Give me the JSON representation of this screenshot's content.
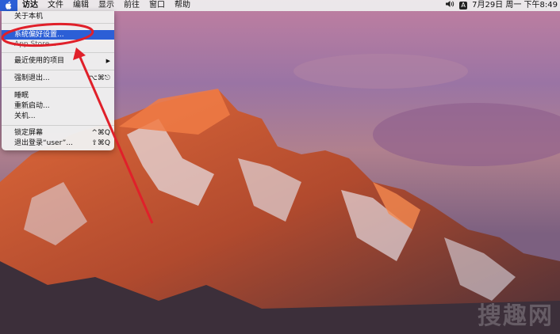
{
  "menubar": {
    "items": [
      "访达",
      "文件",
      "编辑",
      "显示",
      "前往",
      "窗口",
      "帮助"
    ],
    "input_badge": "A",
    "clock": "7月29日 周一 下午8:49"
  },
  "apple_menu": {
    "about": "关于本机",
    "system_prefs": "系统偏好设置...",
    "app_store": "App Store...",
    "recent": "最近使用的项目",
    "force_quit": "强制退出...",
    "force_quit_shortcut": "⌥⌘⎋",
    "sleep": "睡眠",
    "restart": "重新启动...",
    "shutdown": "关机...",
    "lock": "锁定屏幕",
    "lock_shortcut": "^⌘Q",
    "logout": "退出登录“user”...",
    "logout_shortcut": "⇧⌘Q",
    "submenu_arrow": "▶"
  },
  "watermark": "搜趣网",
  "colors": {
    "highlight": "#2c5fd6",
    "annotation": "#e0202a"
  }
}
